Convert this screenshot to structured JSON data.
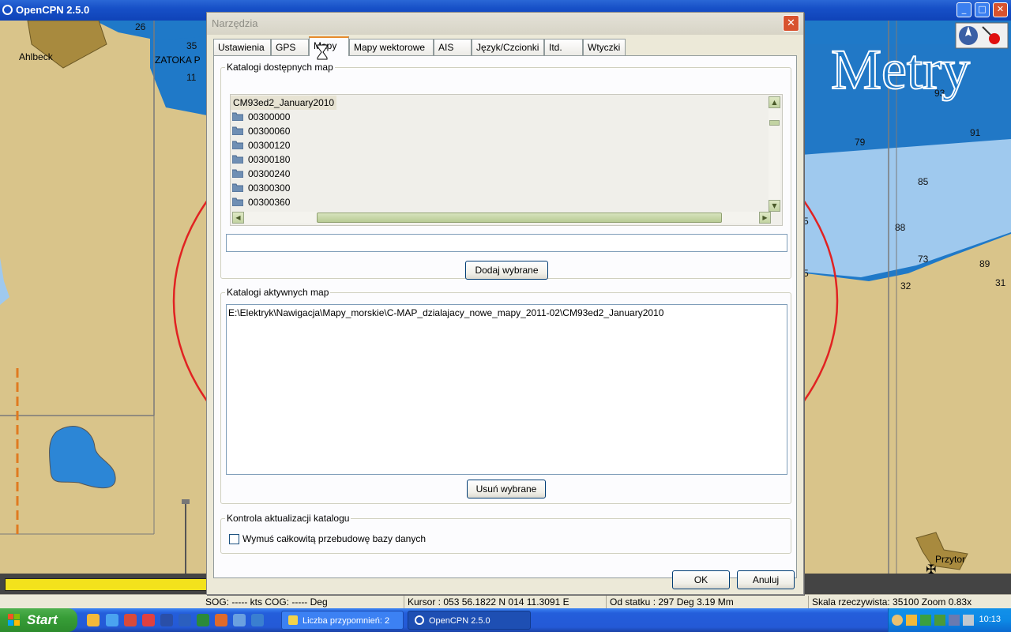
{
  "app": {
    "title": "OpenCPN 2.5.0"
  },
  "chart_overlay": {
    "units_label": "Metry",
    "place_labels": [
      "Ahlbeck",
      "ZATOKA P",
      "Przytor"
    ],
    "soundings": [
      "26",
      "35",
      "11",
      "93",
      "91",
      "79",
      "85",
      "88",
      "73",
      "89",
      "32",
      "31",
      "5",
      "5"
    ]
  },
  "dialog": {
    "title": "Narzędzia",
    "tabs": [
      "Ustawienia",
      "GPS",
      "Mapy",
      "Mapy wektorowe",
      "AIS",
      "Język/Czcionki",
      "Itd.",
      "Wtyczki"
    ],
    "active_tab": "Mapy",
    "available_group": {
      "label": "Katalogi dostępnych map",
      "root": "CM93ed2_January2010",
      "items": [
        "00300000",
        "00300060",
        "00300120",
        "00300180",
        "00300240",
        "00300300",
        "00300360"
      ],
      "path_value": "",
      "add_button": "Dodaj wybrane"
    },
    "active_group": {
      "label": "Katalogi aktywnych map",
      "entries": [
        "E:\\Elektryk\\Nawigacja\\Mapy_morskie\\C-MAP_dzialajacy_nowe_mapy_2011-02\\CM93ed2_January2010"
      ],
      "remove_button": "Usuń wybrane"
    },
    "update_group": {
      "label": "Kontrola aktualizacji katalogu",
      "checkbox_label": "Wymuś całkowitą przebudowę bazy danych",
      "checked": false
    },
    "ok_button": "OK",
    "cancel_button": "Anuluj"
  },
  "statusbar": {
    "sog_cog": "SOG: ----- kts  COG: ----- Deg",
    "cursor": "Kursor :  053 56.1822 N 014 11.3091 E",
    "from_ship": "Od statku :  297 Deg     3.19 Mm",
    "scale": "Skala rzeczywista:     35100  Zoom 0.83x"
  },
  "taskbar": {
    "start_label": "Start",
    "tasks": [
      "Liczba przypomnień: 2",
      "OpenCPN 2.5.0"
    ],
    "clock": "10:13"
  },
  "colors": {
    "land": "#d9c48a",
    "water": "#1f79c8",
    "shallow_water": "#9fc9ee",
    "range_ring": "#e12222",
    "xp_blue": "#245edb",
    "active_tab_accent": "#e68b2c"
  }
}
